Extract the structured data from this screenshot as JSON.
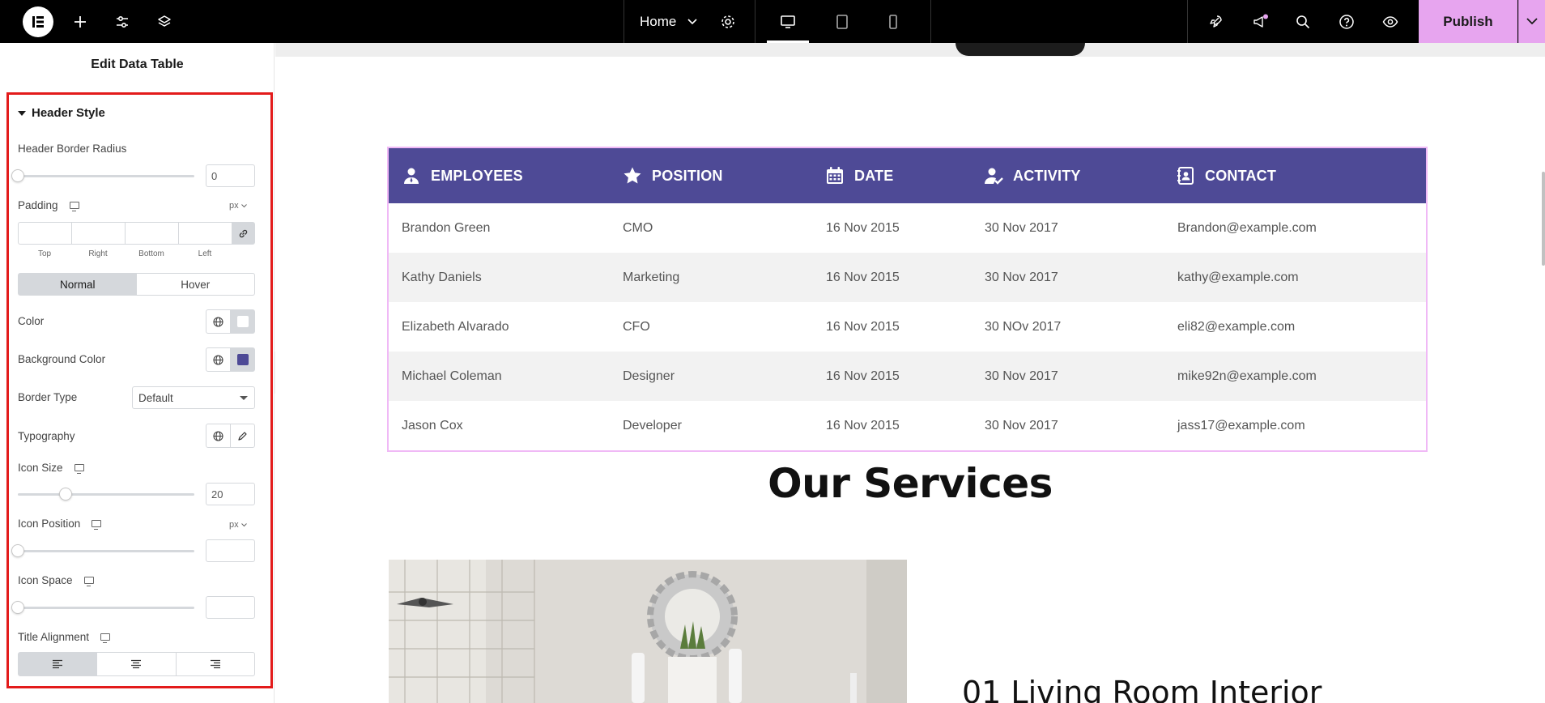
{
  "app": {
    "name": "Elementor"
  },
  "topbar": {
    "icons": [
      "elementor-logo-icon",
      "add-icon",
      "sliders-icon",
      "layers-icon",
      "gear-icon",
      "desktop-icon",
      "tablet-icon",
      "mobile-icon",
      "rocket-icon",
      "megaphone-icon",
      "search-icon",
      "help-icon",
      "eye-icon"
    ],
    "page_selector": "Home",
    "publish_label": "Publish",
    "notification_color": "#e7a5ef"
  },
  "panel": {
    "title": "Edit Data Table",
    "section": "Header Style",
    "header_border_radius": {
      "label": "Header Border Radius",
      "value": "0",
      "slider_fraction": 0.0
    },
    "padding": {
      "label": "Padding",
      "unit": "px",
      "captions": [
        "Top",
        "Right",
        "Bottom",
        "Left"
      ]
    },
    "state_tabs": [
      "Normal",
      "Hover"
    ],
    "color": {
      "label": "Color",
      "value": "#ffffff"
    },
    "background_color": {
      "label": "Background Color",
      "value": "#4e4a96"
    },
    "border_type": {
      "label": "Border Type",
      "value": "Default"
    },
    "typography": {
      "label": "Typography"
    },
    "icon_size": {
      "label": "Icon Size",
      "value": "20",
      "slider_fraction": 0.27
    },
    "icon_position": {
      "label": "Icon Position",
      "unit": "px",
      "value": ""
    },
    "icon_space": {
      "label": "Icon Space",
      "value": ""
    },
    "title_alignment": {
      "label": "Title Alignment",
      "options": [
        "left",
        "center",
        "right"
      ],
      "selected": "left"
    }
  },
  "table": {
    "header_bg": "#4e4a96",
    "columns": [
      {
        "label": "EMPLOYEES",
        "icon": "user-icon"
      },
      {
        "label": "POSITION",
        "icon": "star-icon"
      },
      {
        "label": "DATE",
        "icon": "calendar-icon"
      },
      {
        "label": "ACTIVITY",
        "icon": "user-check-icon"
      },
      {
        "label": "CONTACT",
        "icon": "contact-book-icon"
      }
    ],
    "rows": [
      [
        "Brandon Green",
        "CMO",
        "16 Nov 2015",
        "30 Nov 2017",
        "Brandon@example.com"
      ],
      [
        "Kathy Daniels",
        "Marketing",
        "16 Nov 2015",
        "30 Nov 2017",
        "kathy@example.com"
      ],
      [
        "Elizabeth Alvarado",
        "CFO",
        "16 Nov 2015",
        "30 NOv 2017",
        "eli82@example.com"
      ],
      [
        "Michael Coleman",
        "Designer",
        "16 Nov 2015",
        "30 Nov 2017",
        "mike92n@example.com"
      ],
      [
        "Jason Cox",
        "Developer",
        "16 Nov 2015",
        "30 Nov 2017",
        "jass17@example.com"
      ]
    ]
  },
  "services": {
    "heading": "Our Services",
    "item_title": "01 Living Room Interior"
  }
}
